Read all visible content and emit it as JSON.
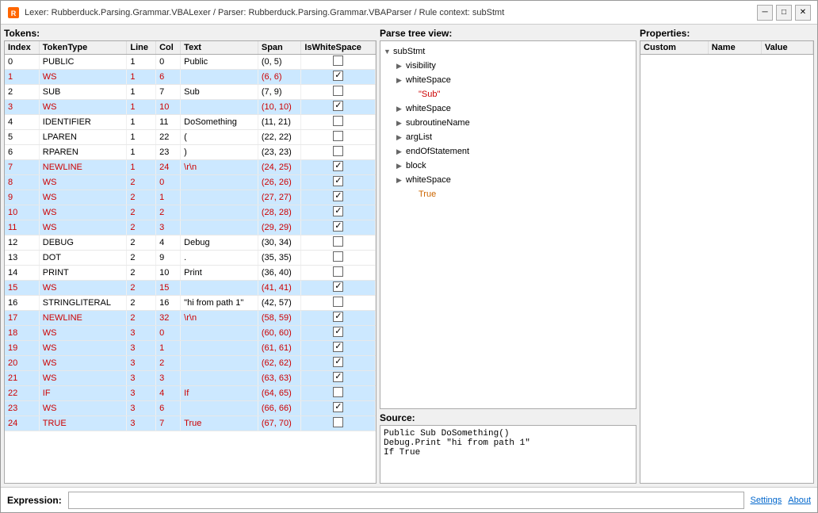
{
  "title_bar": {
    "text": "Lexer: Rubberduck.Parsing.Grammar.VBALexer  /  Parser: Rubberduck.Parsing.Grammar.VBAParser  /  Rule context: subStmt",
    "min_label": "─",
    "max_label": "□",
    "close_label": "✕"
  },
  "tokens_panel": {
    "title": "Tokens:",
    "columns": [
      "Index",
      "TokenType",
      "Line",
      "Col",
      "Text",
      "Span",
      "IsWhiteSpace"
    ],
    "rows": [
      {
        "index": "0",
        "type": "PUBLIC",
        "line": "1",
        "col": "0",
        "text": "Public",
        "span": "(0, 5)",
        "ws": false,
        "highlight": false
      },
      {
        "index": "1",
        "type": "WS",
        "line": "1",
        "col": "6",
        "text": "",
        "span": "(6, 6)",
        "ws": true,
        "highlight": true
      },
      {
        "index": "2",
        "type": "SUB",
        "line": "1",
        "col": "7",
        "text": "Sub",
        "span": "(7, 9)",
        "ws": false,
        "highlight": false
      },
      {
        "index": "3",
        "type": "WS",
        "line": "1",
        "col": "10",
        "text": "",
        "span": "(10, 10)",
        "ws": true,
        "highlight": true
      },
      {
        "index": "4",
        "type": "IDENTIFIER",
        "line": "1",
        "col": "11",
        "text": "DoSomething",
        "span": "(11, 21)",
        "ws": false,
        "highlight": false
      },
      {
        "index": "5",
        "type": "LPAREN",
        "line": "1",
        "col": "22",
        "text": "(",
        "span": "(22, 22)",
        "ws": false,
        "highlight": false
      },
      {
        "index": "6",
        "type": "RPAREN",
        "line": "1",
        "col": "23",
        "text": ")",
        "span": "(23, 23)",
        "ws": false,
        "highlight": false
      },
      {
        "index": "7",
        "type": "NEWLINE",
        "line": "1",
        "col": "24",
        "text": "\\r\\n",
        "span": "(24, 25)",
        "ws": true,
        "highlight": true
      },
      {
        "index": "8",
        "type": "WS",
        "line": "2",
        "col": "0",
        "text": "",
        "span": "(26, 26)",
        "ws": true,
        "highlight": true
      },
      {
        "index": "9",
        "type": "WS",
        "line": "2",
        "col": "1",
        "text": "",
        "span": "(27, 27)",
        "ws": true,
        "highlight": true
      },
      {
        "index": "10",
        "type": "WS",
        "line": "2",
        "col": "2",
        "text": "",
        "span": "(28, 28)",
        "ws": true,
        "highlight": true
      },
      {
        "index": "11",
        "type": "WS",
        "line": "2",
        "col": "3",
        "text": "",
        "span": "(29, 29)",
        "ws": true,
        "highlight": true
      },
      {
        "index": "12",
        "type": "DEBUG",
        "line": "2",
        "col": "4",
        "text": "Debug",
        "span": "(30, 34)",
        "ws": false,
        "highlight": false
      },
      {
        "index": "13",
        "type": "DOT",
        "line": "2",
        "col": "9",
        "text": ".",
        "span": "(35, 35)",
        "ws": false,
        "highlight": false
      },
      {
        "index": "14",
        "type": "PRINT",
        "line": "2",
        "col": "10",
        "text": "Print",
        "span": "(36, 40)",
        "ws": false,
        "highlight": false
      },
      {
        "index": "15",
        "type": "WS",
        "line": "2",
        "col": "15",
        "text": "",
        "span": "(41, 41)",
        "ws": true,
        "highlight": true
      },
      {
        "index": "16",
        "type": "STRINGLITERAL",
        "line": "2",
        "col": "16",
        "text": "\"hi from path 1\"",
        "span": "(42, 57)",
        "ws": false,
        "highlight": false
      },
      {
        "index": "17",
        "type": "NEWLINE",
        "line": "2",
        "col": "32",
        "text": "\\r\\n",
        "span": "(58, 59)",
        "ws": true,
        "highlight": true
      },
      {
        "index": "18",
        "type": "WS",
        "line": "3",
        "col": "0",
        "text": "",
        "span": "(60, 60)",
        "ws": true,
        "highlight": true
      },
      {
        "index": "19",
        "type": "WS",
        "line": "3",
        "col": "1",
        "text": "",
        "span": "(61, 61)",
        "ws": true,
        "highlight": true
      },
      {
        "index": "20",
        "type": "WS",
        "line": "3",
        "col": "2",
        "text": "",
        "span": "(62, 62)",
        "ws": true,
        "highlight": true
      },
      {
        "index": "21",
        "type": "WS",
        "line": "3",
        "col": "3",
        "text": "",
        "span": "(63, 63)",
        "ws": true,
        "highlight": true
      },
      {
        "index": "22",
        "type": "IF",
        "line": "3",
        "col": "4",
        "text": "If",
        "span": "(64, 65)",
        "ws": false,
        "highlight": true
      },
      {
        "index": "23",
        "type": "WS",
        "line": "3",
        "col": "6",
        "text": "",
        "span": "(66, 66)",
        "ws": true,
        "highlight": true
      },
      {
        "index": "24",
        "type": "TRUE",
        "line": "3",
        "col": "7",
        "text": "True",
        "span": "(67, 70)",
        "ws": false,
        "highlight": true
      }
    ]
  },
  "parse_tree": {
    "title": "Parse tree view:",
    "nodes": [
      {
        "label": "subStmt",
        "indent": 0,
        "arrow": "▼",
        "color": "normal"
      },
      {
        "label": "visibility",
        "indent": 1,
        "arrow": "▶",
        "color": "normal"
      },
      {
        "label": "whiteSpace",
        "indent": 1,
        "arrow": "▶",
        "color": "normal"
      },
      {
        "label": "\"Sub\"",
        "indent": 2,
        "arrow": "",
        "color": "string"
      },
      {
        "label": "whiteSpace",
        "indent": 1,
        "arrow": "▶",
        "color": "normal"
      },
      {
        "label": "subroutineName",
        "indent": 1,
        "arrow": "▶",
        "color": "normal"
      },
      {
        "label": "argList",
        "indent": 1,
        "arrow": "▶",
        "color": "normal"
      },
      {
        "label": "endOfStatement",
        "indent": 1,
        "arrow": "▶",
        "color": "normal"
      },
      {
        "label": "block",
        "indent": 1,
        "arrow": "▶",
        "color": "normal"
      },
      {
        "label": "whiteSpace",
        "indent": 1,
        "arrow": "▶",
        "color": "normal"
      },
      {
        "label": "True",
        "indent": 2,
        "arrow": "",
        "color": "orange"
      }
    ]
  },
  "source": {
    "title": "Source:",
    "lines": [
      "Public Sub DoSomething()",
      "    Debug.Print \"hi from path 1\"",
      "    If True"
    ]
  },
  "properties": {
    "title": "Properties:",
    "columns": [
      "Custom",
      "Name",
      "Value"
    ],
    "rows": []
  },
  "bottom_bar": {
    "expr_label": "Expression:",
    "expr_placeholder": "",
    "settings_label": "Settings",
    "about_label": "About"
  }
}
